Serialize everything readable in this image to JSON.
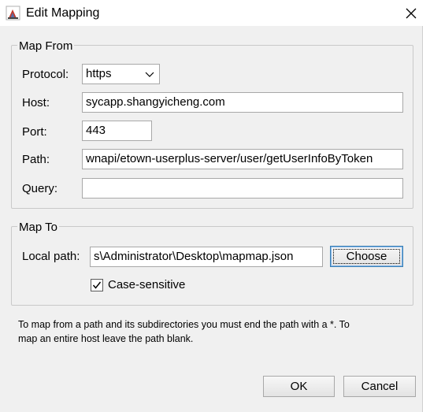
{
  "window": {
    "title": "Edit Mapping",
    "icon": "java-cup-icon",
    "close_icon": "close-icon"
  },
  "map_from": {
    "legend": "Map From",
    "protocol_label": "Protocol:",
    "protocol_value": "https",
    "host_label": "Host:",
    "host_value": "sycapp.shangyicheng.com",
    "port_label": "Port:",
    "port_value": "443",
    "path_label": "Path:",
    "path_value": "wnapi/etown-userplus-server/user/getUserInfoByToken",
    "query_label": "Query:",
    "query_value": ""
  },
  "map_to": {
    "legend": "Map To",
    "local_path_label": "Local path:",
    "local_path_value": "s\\Administrator\\Desktop\\mapmap.json",
    "choose_label": "Choose",
    "case_sensitive_label": "Case-sensitive",
    "case_sensitive_checked": true
  },
  "hint": {
    "line1": "To map from a path and its subdirectories you must end the path with a *. To",
    "line2": "map an entire host leave the path blank."
  },
  "buttons": {
    "ok_label": "OK",
    "cancel_label": "Cancel"
  },
  "colors": {
    "dialog_bg": "#f0f0f0",
    "focus_border": "#3c7fb1"
  }
}
